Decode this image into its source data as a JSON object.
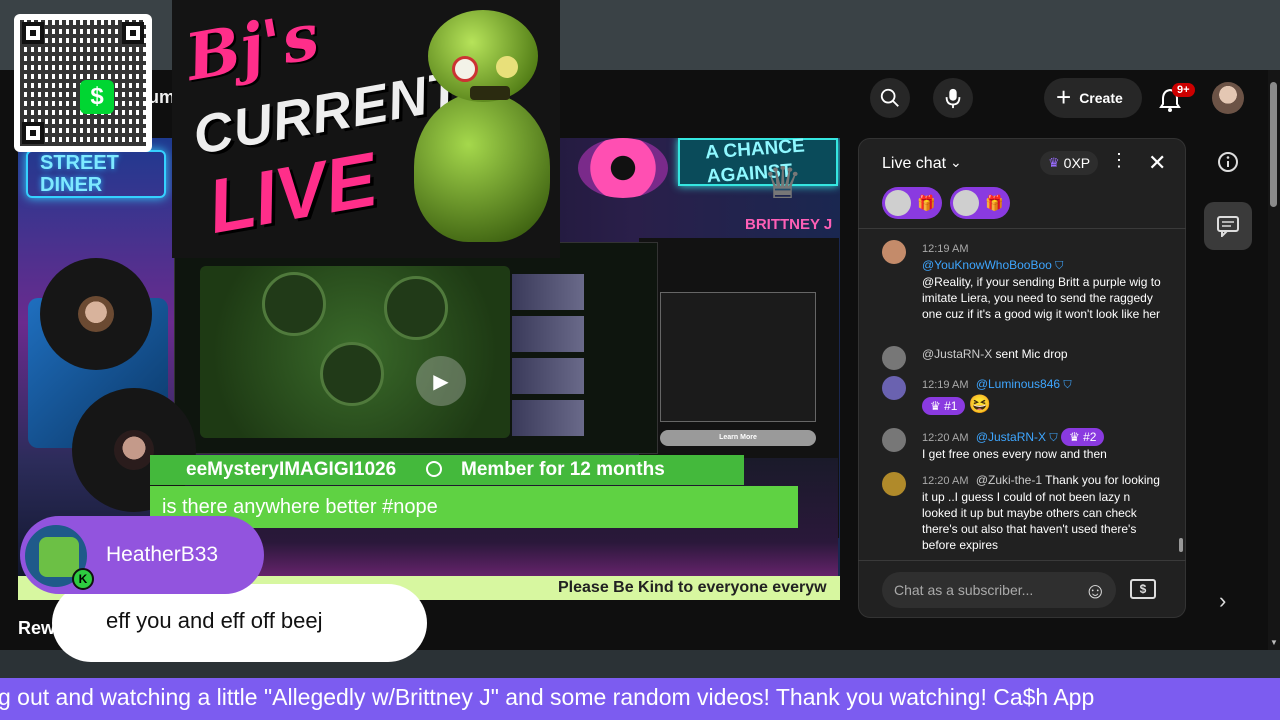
{
  "header": {
    "channel_partial": "um",
    "create_label": "Create",
    "notification_count": "9+"
  },
  "overlay": {
    "logo_line1": "Bj's",
    "logo_line2": "CURRENT",
    "logo_line3": "LIVE",
    "diner_sign": "STREET\nDINER",
    "chance_sign": "A CHANCE\nAGAINST",
    "brittney_sign": "BRITTNEY J",
    "learn_more": "Learn More",
    "inner_ticker": "Please Be Kind to everyone everyw",
    "member_name": "eeMysteryIMAGIGI1026",
    "member_since": "Member for 12 months",
    "member_message": "is there anywhere better #nope",
    "chat_user": "HeatherB33",
    "chat_user_badge": "K",
    "chat_message": "eff you and eff off beej",
    "rew_label": "Rew",
    "bottom_ticker": "g out and watching a little \"Allegedly w/Brittney J\" and some random videos! Thank you watching! Ca$h App"
  },
  "chat": {
    "title": "Live chat",
    "xp": "0XP",
    "input_placeholder": "Chat as a subscriber...",
    "messages": [
      {
        "time": "12:19 AM",
        "author": "@YouKnowWhoBooBoo",
        "text": "@Reality, if your sending Britt a purple wig to imitate Liera, you need to send the raggedy one cuz if it's a good wig it won't look like her"
      },
      {
        "time": "",
        "author": "@JustaRN-X",
        "text": "sent Mic drop"
      },
      {
        "time": "12:19 AM",
        "author": "@Luminous846",
        "rank": "#1",
        "text": "😆"
      },
      {
        "time": "12:20 AM",
        "author": "@JustaRN-X",
        "rank": "#2",
        "text": "I get free ones every now and then"
      },
      {
        "time": "12:20 AM",
        "author": "@Zuki-the-1",
        "text": "Thank you for looking it up ..I guess I could of not been lazy n looked it up but maybe others can check there's out also that haven't used there's before expires"
      }
    ]
  },
  "colors": {
    "accent_purple": "#9254de",
    "member_green": "#44b93c",
    "ticker_purple": "#7c5cf0",
    "link_blue": "#3ea6ff"
  }
}
